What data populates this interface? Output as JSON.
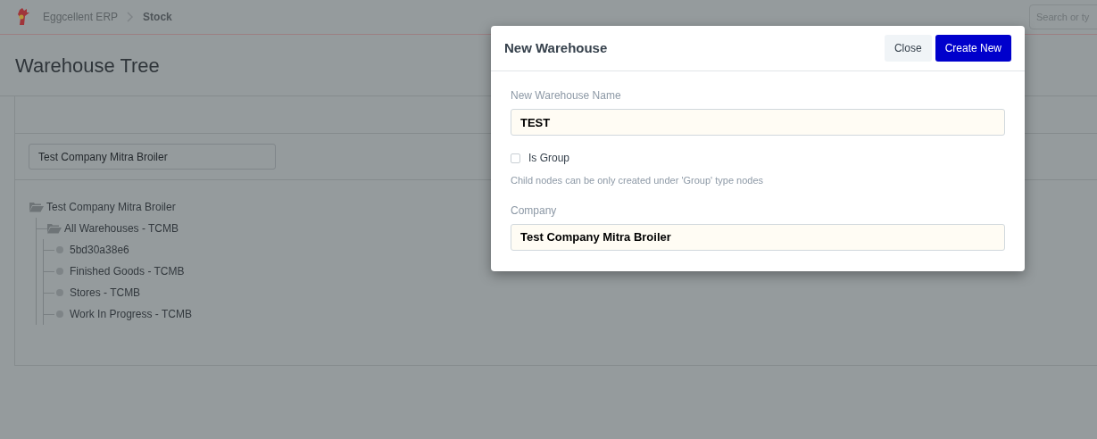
{
  "navbar": {
    "breadcrumbs": [
      "Eggcellent ERP",
      "Stock"
    ],
    "search": {
      "placeholder": "Search or ty"
    }
  },
  "page": {
    "title": "Warehouse Tree"
  },
  "filter": {
    "value": "Test Company Mitra Broiler"
  },
  "tree": [
    {
      "label": "Test Company Mitra Broiler",
      "kind": "group",
      "children": [
        {
          "label": "All Warehouses - TCMB",
          "kind": "group",
          "children": [
            {
              "label": "5bd30a38e6",
              "kind": "leaf"
            },
            {
              "label": "Finished Goods - TCMB",
              "kind": "leaf"
            },
            {
              "label": "Stores - TCMB",
              "kind": "leaf"
            },
            {
              "label": "Work In Progress - TCMB",
              "kind": "leaf"
            }
          ]
        }
      ]
    }
  ],
  "dialog": {
    "title": "New Warehouse",
    "buttons": [
      {
        "label": "Close",
        "kind": "secondary"
      },
      {
        "label": "Create New",
        "kind": "primary"
      }
    ],
    "name_field": {
      "label": "New Warehouse Name",
      "value": "TEST"
    },
    "is_group": {
      "label": "Is Group",
      "checked": false,
      "help": "Child nodes can be only created under 'Group' type nodes"
    },
    "company_field": {
      "label": "Company",
      "value": "Test Company Mitra Broiler"
    }
  }
}
